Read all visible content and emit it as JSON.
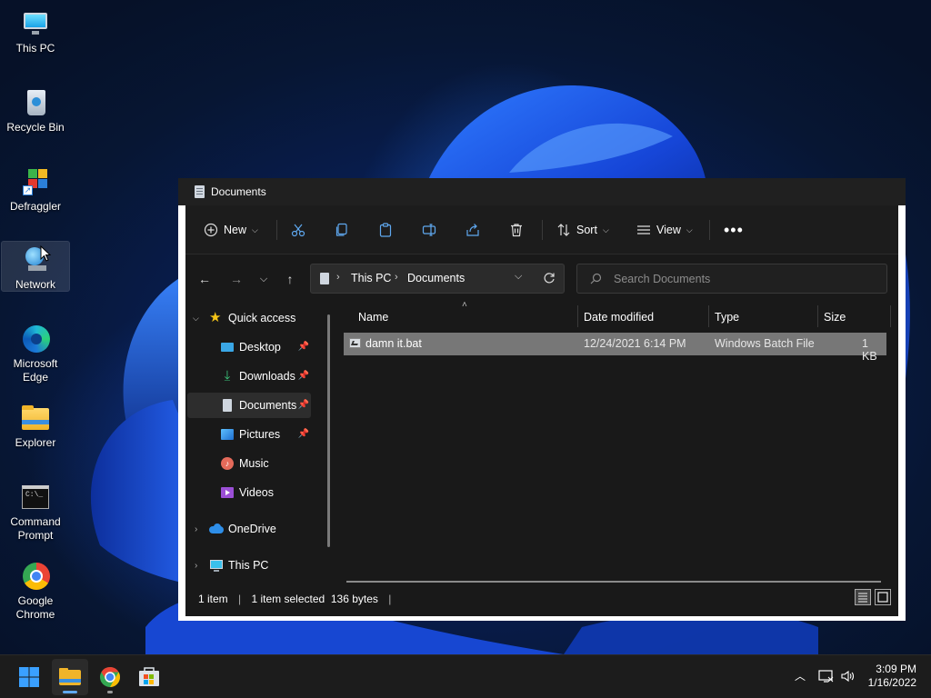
{
  "desktop": {
    "icons": [
      {
        "label": "This PC",
        "icon": "monitor-icon"
      },
      {
        "label": "Recycle Bin",
        "icon": "recycle-bin-icon"
      },
      {
        "label": "Defraggler",
        "icon": "defraggler-icon"
      },
      {
        "label": "Network",
        "icon": "network-icon"
      },
      {
        "label": "Microsoft Edge",
        "icon": "edge-icon"
      },
      {
        "label": "Explorer",
        "icon": "folder-icon"
      },
      {
        "label": "Command Prompt",
        "icon": "cmd-icon"
      },
      {
        "label": "Google Chrome",
        "icon": "chrome-icon"
      }
    ]
  },
  "window": {
    "title": "Documents",
    "toolbar": {
      "new_label": "New",
      "sort_label": "Sort",
      "view_label": "View"
    },
    "address": {
      "crumbs": [
        "This PC",
        "Documents"
      ]
    },
    "search": {
      "placeholder": "Search Documents"
    },
    "nav": {
      "quick_access": "Quick access",
      "items": [
        {
          "label": "Desktop",
          "pinned": true
        },
        {
          "label": "Downloads",
          "pinned": true
        },
        {
          "label": "Documents",
          "pinned": true,
          "selected": true
        },
        {
          "label": "Pictures",
          "pinned": true
        },
        {
          "label": "Music",
          "pinned": false
        },
        {
          "label": "Videos",
          "pinned": false
        }
      ],
      "onedrive": "OneDrive",
      "this_pc": "This PC"
    },
    "columns": {
      "name": "Name",
      "date": "Date modified",
      "type": "Type",
      "size": "Size"
    },
    "files": [
      {
        "name": "damn it.bat",
        "date": "12/24/2021 6:14 PM",
        "type": "Windows Batch File",
        "size": "1 KB"
      }
    ],
    "status": {
      "count": "1 item",
      "selection": "1 item selected  136 bytes"
    }
  },
  "taskbar": {
    "time": "3:09 PM",
    "date": "1/16/2022"
  },
  "colors": {
    "accent": "#5fa8f0",
    "window_bg": "#191919",
    "selected_row": "#777777"
  }
}
